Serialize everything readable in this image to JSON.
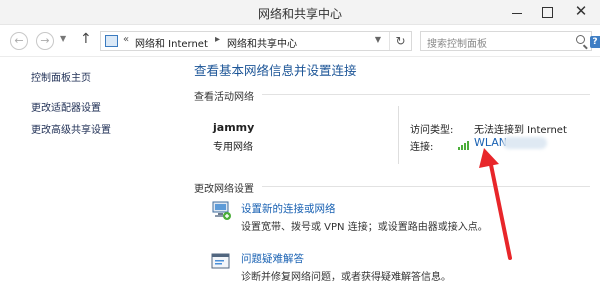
{
  "window": {
    "title": "网络和共享中心"
  },
  "nav": {
    "breadcrumb": [
      "网络和 Internet",
      "网络和共享中心"
    ],
    "search_placeholder": "搜索控制面板"
  },
  "sidebar": {
    "items": [
      "控制面板主页",
      "更改适配器设置",
      "更改高级共享设置"
    ]
  },
  "main": {
    "title": "查看基本网络信息并设置连接",
    "active_header": "查看活动网络",
    "network": {
      "name": "jammy",
      "type": "专用网络",
      "access_label": "访问类型:",
      "access_value": "无法连接到 Internet",
      "conn_label": "连接:",
      "conn_value": "WLAN"
    },
    "change_header": "更改网络设置",
    "actions": [
      {
        "link": "设置新的连接或网络",
        "desc": "设置宽带、拨号或 VPN 连接；或设置路由器或接入点。",
        "icon": "network-setup-icon"
      },
      {
        "link": "问题疑难解答",
        "desc": "诊断并修复网络问题，或者获得疑难解答信息。",
        "icon": "troubleshoot-icon"
      }
    ]
  },
  "colors": {
    "link": "#1a62b3",
    "title": "#1c5597",
    "arrow": "#e8262a",
    "wifi": "#4cae3a"
  }
}
